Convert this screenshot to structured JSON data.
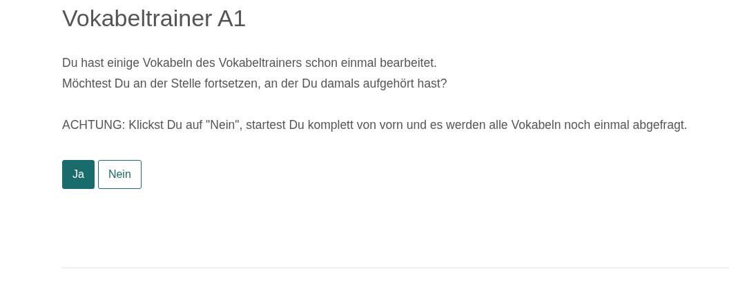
{
  "title": "Vokabeltrainer A1",
  "paragraphs": [
    [
      "Du hast einige Vokabeln des Vokabeltrainers schon einmal bearbeitet.",
      "Möchtest Du an der Stelle fortsetzen, an der Du damals aufgehört hast?"
    ],
    [
      "ACHTUNG: Klickst Du auf \"Nein\", startest Du komplett von vorn und es werden alle Vokabeln noch einmal abgefragt."
    ]
  ],
  "buttons": [
    {
      "label": "Ja",
      "kind": "primary"
    },
    {
      "label": "Nein",
      "kind": "outline"
    }
  ]
}
